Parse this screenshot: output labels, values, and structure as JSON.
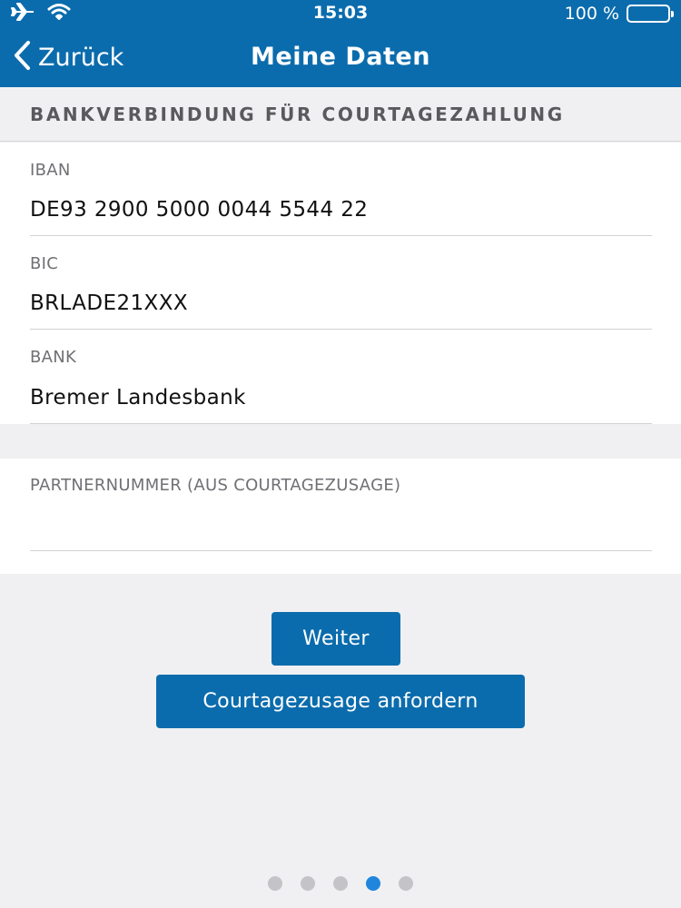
{
  "status_bar": {
    "time": "15:03",
    "battery_text": "100 %",
    "battery_level": 1.0,
    "icons": [
      "airplane-icon",
      "wifi-icon",
      "battery-icon"
    ]
  },
  "nav": {
    "back_label": "Zurück",
    "title": "Meine Daten"
  },
  "section": {
    "header": "BANKVERBINDUNG FÜR COURTAGEZAHLUNG"
  },
  "fields": [
    {
      "label": "IBAN",
      "value": "DE93 2900 5000 0044 5544 22"
    },
    {
      "label": "BIC",
      "value": "BRLADE21XXX"
    },
    {
      "label": "BANK",
      "value": "Bremer Landesbank"
    }
  ],
  "partner": {
    "label": "PARTNERNUMMER (AUS COURTAGEZUSAGE)",
    "value": ""
  },
  "buttons": {
    "next": "Weiter",
    "request": "Courtagezusage anfordern"
  },
  "pagination": {
    "total": 5,
    "active_index": 3
  },
  "colors": {
    "brand": "#0b6cad",
    "active_dot": "#1f86dc",
    "background": "#f0f0f2"
  }
}
